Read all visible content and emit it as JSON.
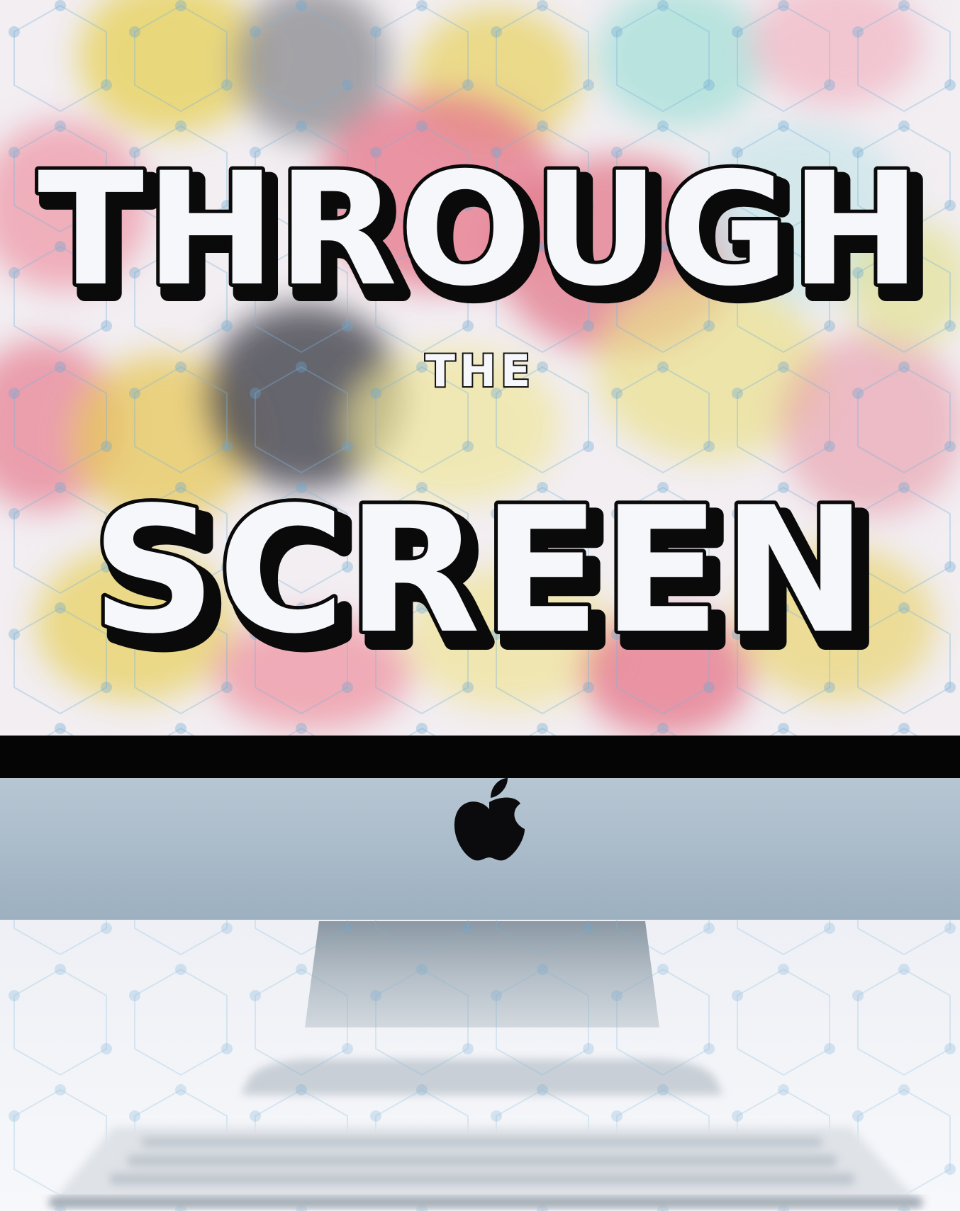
{
  "cover": {
    "title_top": "THROUGH",
    "title_middle": "THE",
    "title_bottom": "SCREEN"
  },
  "colors": {
    "text_fill": "#f5f7fb",
    "text_stroke": "#0a0a0a",
    "screen_bezel": "#050505",
    "chin": "#a9bccc",
    "stand": "#9aa7b2",
    "desk": "#f1f2f6",
    "keyboard": "#d9dde3"
  },
  "icons": {
    "logo": "apple-logo-icon"
  }
}
